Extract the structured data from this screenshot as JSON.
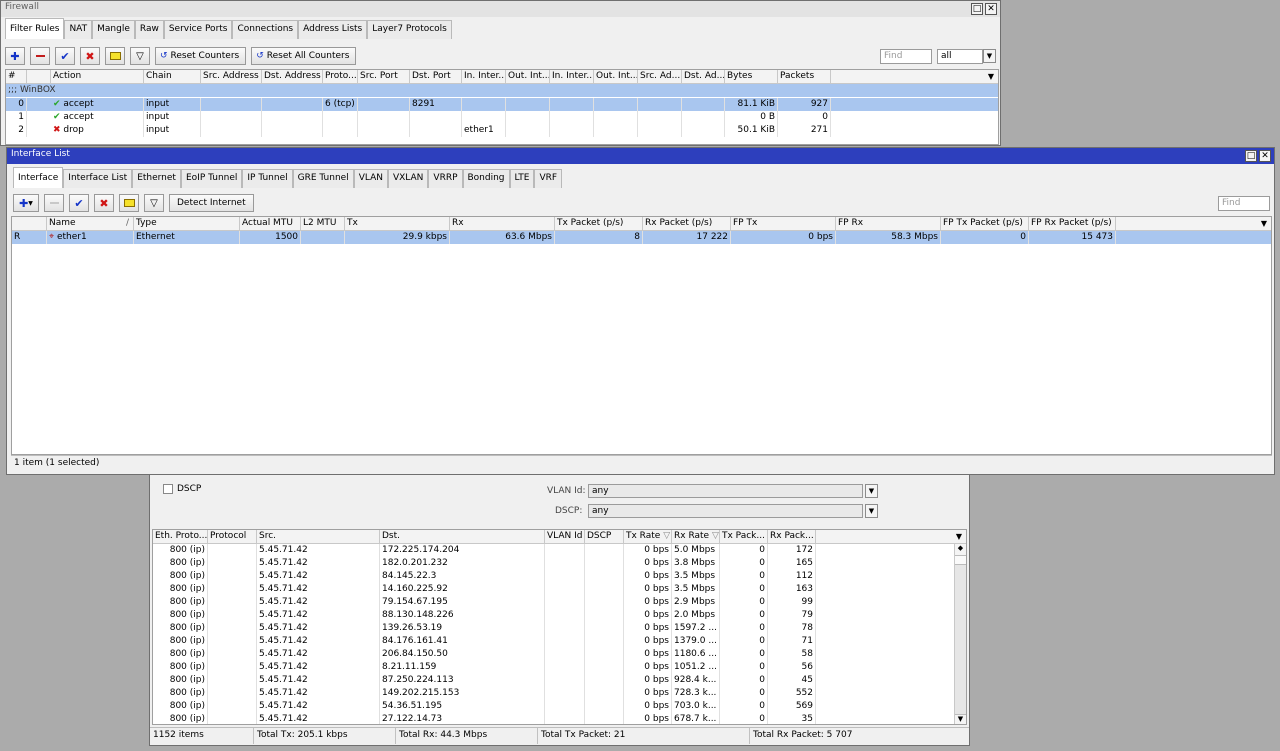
{
  "firewall": {
    "title": "Firewall",
    "tabs": [
      "Filter Rules",
      "NAT",
      "Mangle",
      "Raw",
      "Service Ports",
      "Connections",
      "Address Lists",
      "Layer7 Protocols"
    ],
    "toolbar": {
      "reset_counters": "Reset Counters",
      "reset_all_counters": "Reset All Counters"
    },
    "find_placeholder": "Find",
    "filter_value": "all",
    "columns": [
      "#",
      "Action",
      "Chain",
      "Src. Address",
      "Dst. Address",
      "Proto...",
      "Src. Port",
      "Dst. Port",
      "In. Inter...",
      "Out. Int...",
      "In. Inter...",
      "Out. Int...",
      "Src. Ad...",
      "Dst. Ad...",
      "Bytes",
      "Packets"
    ],
    "group_comment": ";;; WinBOX",
    "rules": [
      {
        "num": "0",
        "action": "accept",
        "chain": "input",
        "proto": "6 (tcp)",
        "dst_port": "8291",
        "in_iface": "",
        "bytes": "81.1 KiB",
        "packets": "927",
        "icon": "check-icon"
      },
      {
        "num": "1",
        "action": "accept",
        "chain": "input",
        "proto": "",
        "dst_port": "",
        "in_iface": "",
        "bytes": "0 B",
        "packets": "0",
        "icon": "check-icon"
      },
      {
        "num": "2",
        "action": "drop",
        "chain": "input",
        "proto": "",
        "dst_port": "",
        "in_iface": "ether1",
        "bytes": "50.1 KiB",
        "packets": "271",
        "icon": "x-icon"
      }
    ]
  },
  "interface_list": {
    "title": "Interface List",
    "tabs": [
      "Interface",
      "Interface List",
      "Ethernet",
      "EoIP Tunnel",
      "IP Tunnel",
      "GRE Tunnel",
      "VLAN",
      "VXLAN",
      "VRRP",
      "Bonding",
      "LTE",
      "VRF"
    ],
    "toolbar": {
      "detect_internet": "Detect Internet"
    },
    "find_placeholder": "Find",
    "columns": [
      "",
      "Name",
      "Type",
      "Actual MTU",
      "L2 MTU",
      "Tx",
      "Rx",
      "Tx Packet (p/s)",
      "Rx Packet (p/s)",
      "FP Tx",
      "FP Rx",
      "FP Tx Packet (p/s)",
      "FP Rx Packet (p/s)"
    ],
    "sort_marker": "/",
    "rows": [
      {
        "flag": "R",
        "name": "ether1",
        "type": "Ethernet",
        "mtu": "1500",
        "l2mtu": "",
        "tx": "29.9 kbps",
        "rx": "63.6 Mbps",
        "tx_pps": "8",
        "rx_pps": "17 222",
        "fp_tx": "0 bps",
        "fp_rx": "58.3 Mbps",
        "fp_tx_pps": "0",
        "fp_rx_pps": "15 473"
      }
    ],
    "status": "1 item (1 selected)"
  },
  "torch": {
    "dscp_label": "DSCP",
    "vlan_id_label": "VLAN Id:",
    "vlan_id_value": "any",
    "dscp_field_label": "DSCP:",
    "dscp_value": "any",
    "columns": [
      "Eth. Proto...",
      "Protocol",
      "Src.",
      "Dst.",
      "VLAN Id",
      "DSCP",
      "Tx Rate",
      "Rx Rate",
      "Tx Pack...",
      "Rx Pack..."
    ],
    "rows": [
      {
        "eth": "800 (ip)",
        "src": "5.45.71.42",
        "dst": "172.225.174.204",
        "tx": "0 bps",
        "rx": "5.0 Mbps",
        "txp": "0",
        "rxp": "172"
      },
      {
        "eth": "800 (ip)",
        "src": "5.45.71.42",
        "dst": "182.0.201.232",
        "tx": "0 bps",
        "rx": "3.8 Mbps",
        "txp": "0",
        "rxp": "165"
      },
      {
        "eth": "800 (ip)",
        "src": "5.45.71.42",
        "dst": "84.145.22.3",
        "tx": "0 bps",
        "rx": "3.5 Mbps",
        "txp": "0",
        "rxp": "112"
      },
      {
        "eth": "800 (ip)",
        "src": "5.45.71.42",
        "dst": "14.160.225.92",
        "tx": "0 bps",
        "rx": "3.5 Mbps",
        "txp": "0",
        "rxp": "163"
      },
      {
        "eth": "800 (ip)",
        "src": "5.45.71.42",
        "dst": "79.154.67.195",
        "tx": "0 bps",
        "rx": "2.9 Mbps",
        "txp": "0",
        "rxp": "99"
      },
      {
        "eth": "800 (ip)",
        "src": "5.45.71.42",
        "dst": "88.130.148.226",
        "tx": "0 bps",
        "rx": "2.0 Mbps",
        "txp": "0",
        "rxp": "79"
      },
      {
        "eth": "800 (ip)",
        "src": "5.45.71.42",
        "dst": "139.26.53.19",
        "tx": "0 bps",
        "rx": "1597.2 ...",
        "txp": "0",
        "rxp": "78"
      },
      {
        "eth": "800 (ip)",
        "src": "5.45.71.42",
        "dst": "84.176.161.41",
        "tx": "0 bps",
        "rx": "1379.0 ...",
        "txp": "0",
        "rxp": "71"
      },
      {
        "eth": "800 (ip)",
        "src": "5.45.71.42",
        "dst": "206.84.150.50",
        "tx": "0 bps",
        "rx": "1180.6 ...",
        "txp": "0",
        "rxp": "58"
      },
      {
        "eth": "800 (ip)",
        "src": "5.45.71.42",
        "dst": "8.21.11.159",
        "tx": "0 bps",
        "rx": "1051.2 ...",
        "txp": "0",
        "rxp": "56"
      },
      {
        "eth": "800 (ip)",
        "src": "5.45.71.42",
        "dst": "87.250.224.113",
        "tx": "0 bps",
        "rx": "928.4 k...",
        "txp": "0",
        "rxp": "45"
      },
      {
        "eth": "800 (ip)",
        "src": "5.45.71.42",
        "dst": "149.202.215.153",
        "tx": "0 bps",
        "rx": "728.3 k...",
        "txp": "0",
        "rxp": "552"
      },
      {
        "eth": "800 (ip)",
        "src": "5.45.71.42",
        "dst": "54.36.51.195",
        "tx": "0 bps",
        "rx": "703.0 k...",
        "txp": "0",
        "rxp": "569"
      },
      {
        "eth": "800 (ip)",
        "src": "5.45.71.42",
        "dst": "27.122.14.73",
        "tx": "0 bps",
        "rx": "678.7 k...",
        "txp": "0",
        "rxp": "35"
      }
    ],
    "status": [
      "1152 items",
      "Total Tx: 205.1 kbps",
      "Total Rx: 44.3 Mbps",
      "Total Tx Packet: 21",
      "Total Rx Packet: 5 707"
    ]
  }
}
